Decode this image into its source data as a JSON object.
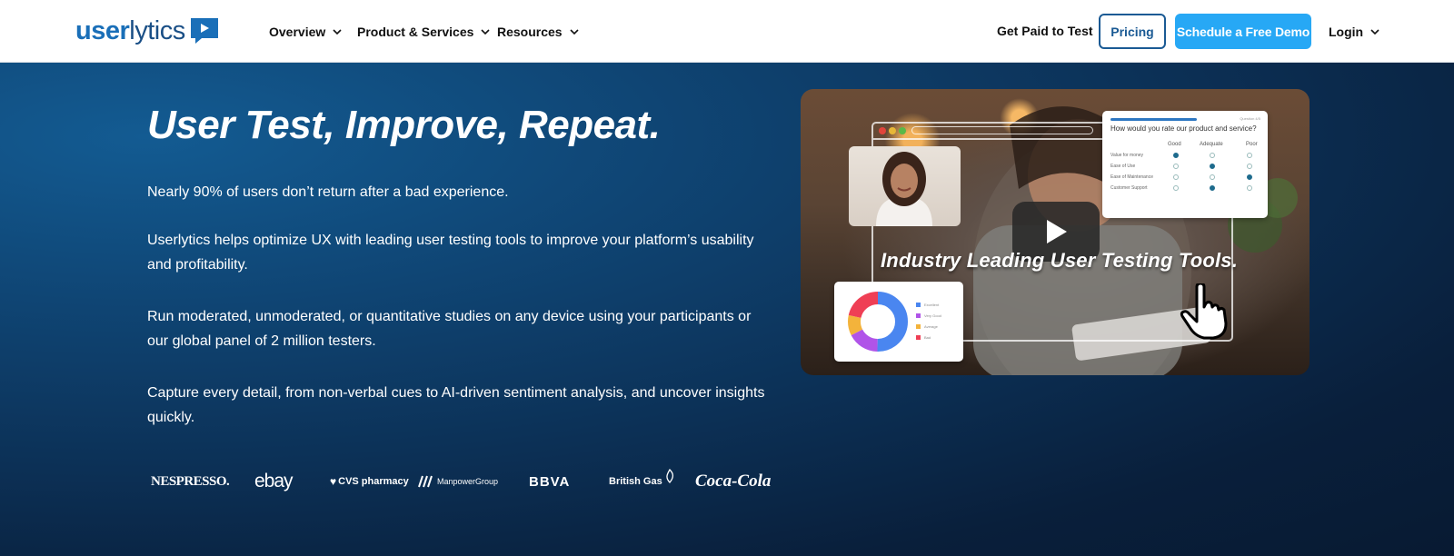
{
  "header": {
    "logo": {
      "part1": "user",
      "part2": "lytics"
    },
    "nav": [
      {
        "label": "Overview"
      },
      {
        "label": "Product & Services"
      },
      {
        "label": "Resources"
      }
    ],
    "get_paid_label": "Get Paid to Test",
    "pricing_label": "Pricing",
    "demo_label": "Schedule a Free Demo",
    "login_label": "Login",
    "accent_color": "#27a8f5",
    "brand_color": "#1a6fb8"
  },
  "hero": {
    "title": "User Test, Improve, Repeat.",
    "paragraphs": [
      "Nearly 90% of users don’t return after a bad experience.",
      "Userlytics helps optimize UX with leading user testing tools to improve your platform’s usability and profitability.",
      "Run moderated, unmoderated, or quantitative studies on any device using your participants or our global panel of 2 million testers.",
      "Capture every detail, from non-verbal cues to AI-driven sentiment analysis, and uncover insights quickly."
    ],
    "client_logos": [
      "NESPRESSO.",
      "ebay",
      "CVS pharmacy",
      "ManpowerGroup",
      "BBVA",
      "British Gas",
      "Coca-Cola"
    ]
  },
  "video": {
    "caption": "Industry Leading User Testing Tools.",
    "play_icon": "play-icon",
    "survey": {
      "question": "How would you rate our product and service?",
      "columns": [
        "Good",
        "Adequate",
        "Poor"
      ],
      "rows": [
        "Value for money",
        "Ease of Use",
        "Ease of Maintenance",
        "Customer Support"
      ],
      "tag": "Question 4/5"
    },
    "donut_legend": [
      "Excellent",
      "Very Good",
      "Average",
      "Bad"
    ]
  }
}
